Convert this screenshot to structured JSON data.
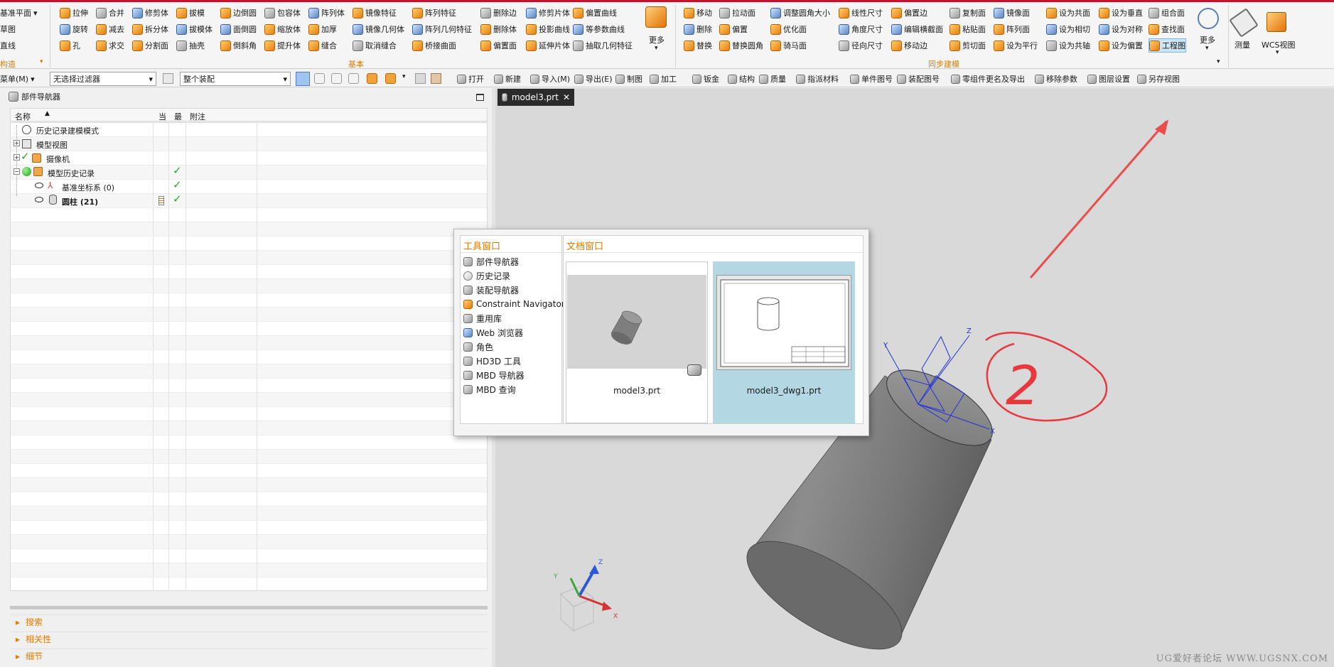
{
  "ribbon": {
    "left_items": {
      "datum_plane": "基准平面",
      "sketch": "草图",
      "line": "直线"
    },
    "construct_group": "构造",
    "basic_group": "基本",
    "sync_group": "同步建模",
    "basic_items": [
      "拉伸",
      "旋转",
      "孔",
      "合并",
      "减去",
      "求交",
      "修剪体",
      "拆分体",
      "分割面",
      "拔模",
      "拔模体",
      "抽壳",
      "边倒圆",
      "面倒圆",
      "倒斜角",
      "包容体",
      "缩放体",
      "提升体",
      "阵列体",
      "加厚",
      "缝合",
      "镜像特征",
      "镜像几何体",
      "取消缝合",
      "阵列特征",
      "阵列几何特征",
      "桥接曲面",
      "删除边",
      "删除体",
      "偏置面",
      "修剪片体",
      "投影曲线",
      "延伸片体",
      "偏置曲线",
      "等参数曲线",
      "抽取几何特征"
    ],
    "more_label": "更多",
    "sync_items": [
      "移动",
      "删除",
      "替换",
      "拉动面",
      "偏置",
      "替换圆角",
      "调整圆角大小",
      "优化面",
      "骑马面",
      "线性尺寸",
      "角度尺寸",
      "径向尺寸",
      "偏置边",
      "编辑横截面",
      "移动边",
      "复制面",
      "粘贴面",
      "剪切面",
      "镜像面",
      "阵列面",
      "设为平行",
      "设为共面",
      "设为相切",
      "设为共轴",
      "设为垂直",
      "设为对称",
      "设为偏置",
      "组合面",
      "查找面",
      "工程图"
    ],
    "measure_label": "测量",
    "wcs_label": "WCS视图"
  },
  "toolbar2": {
    "menu": "菜单(M)",
    "filter": "无选择过滤器",
    "assembly": "整个装配",
    "items": [
      "打开",
      "新建",
      "导入(M)",
      "导出(E)",
      "制图",
      "加工",
      "钣金",
      "结构",
      "质量",
      "指派材料",
      "单件图号",
      "装配图号",
      "零组件更名及导出",
      "移除参数",
      "图层设置",
      "另存视图"
    ]
  },
  "navigator": {
    "title": "部件导航器",
    "col_name": "名称",
    "col_current": "当",
    "col_latest": "最",
    "col_note": "附注",
    "rows": [
      {
        "label": "历史记录建模模式"
      },
      {
        "label": "模型视图"
      },
      {
        "label": "摄像机"
      },
      {
        "label": "模型历史记录"
      },
      {
        "label": "基准坐标系 (0)"
      },
      {
        "label": "圆柱 (21)"
      }
    ],
    "sections": [
      "搜索",
      "相关性",
      "细节"
    ]
  },
  "doc_tab": {
    "label": "model3.prt"
  },
  "popup": {
    "tool_title": "工具窗口",
    "doc_title": "文档窗口",
    "tools": [
      "部件导航器",
      "历史记录",
      "装配导航器",
      "Constraint Navigator",
      "重用库",
      "Web 浏览器",
      "角色",
      "HD3D 工具",
      "MBD 导航器",
      "MBD 查询"
    ],
    "docs": [
      {
        "name": "model3.prt"
      },
      {
        "name": "model3_dwg1.prt"
      }
    ]
  },
  "annotation": {
    "number": "2"
  },
  "axis_labels": {
    "x": "X",
    "y": "Y",
    "z": "Z"
  },
  "watermark": "UG爱好者论坛 WWW.UGSNX.COM",
  "colors": {
    "accent": "#e07b00",
    "annotation": "#e8383d",
    "selected_card": "#b3d8e3"
  }
}
